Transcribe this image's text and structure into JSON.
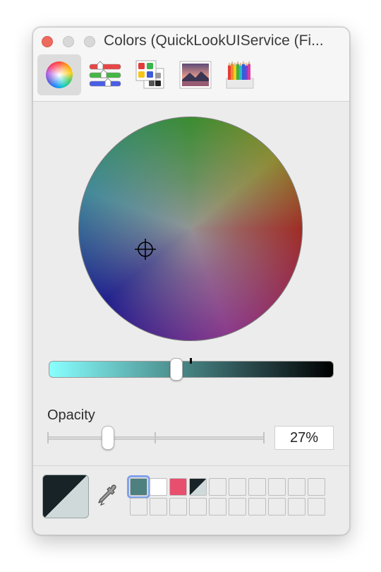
{
  "window": {
    "title": "Colors (QuickLookUIService (Fi..."
  },
  "toolbar": {
    "modes": [
      {
        "name": "color-wheel",
        "selected": true
      },
      {
        "name": "color-sliders",
        "selected": false
      },
      {
        "name": "color-palettes",
        "selected": false
      },
      {
        "name": "image-palettes",
        "selected": false
      },
      {
        "name": "pencils",
        "selected": false
      }
    ]
  },
  "opacity": {
    "label": "Opacity",
    "value_text": "27%",
    "value": 0.27
  },
  "current_color": {
    "dark": "#172326",
    "light": "#cfd9da"
  },
  "swatches": [
    {
      "color": "#4f8080",
      "selected": true
    },
    {
      "color": "#ffffff",
      "selected": false
    },
    {
      "color": "#e84f6e",
      "selected": false
    },
    {
      "color": "split-dark-light",
      "selected": false
    }
  ],
  "colors": {
    "accent": "#7fa2ea",
    "close": "#ee6a5e"
  }
}
